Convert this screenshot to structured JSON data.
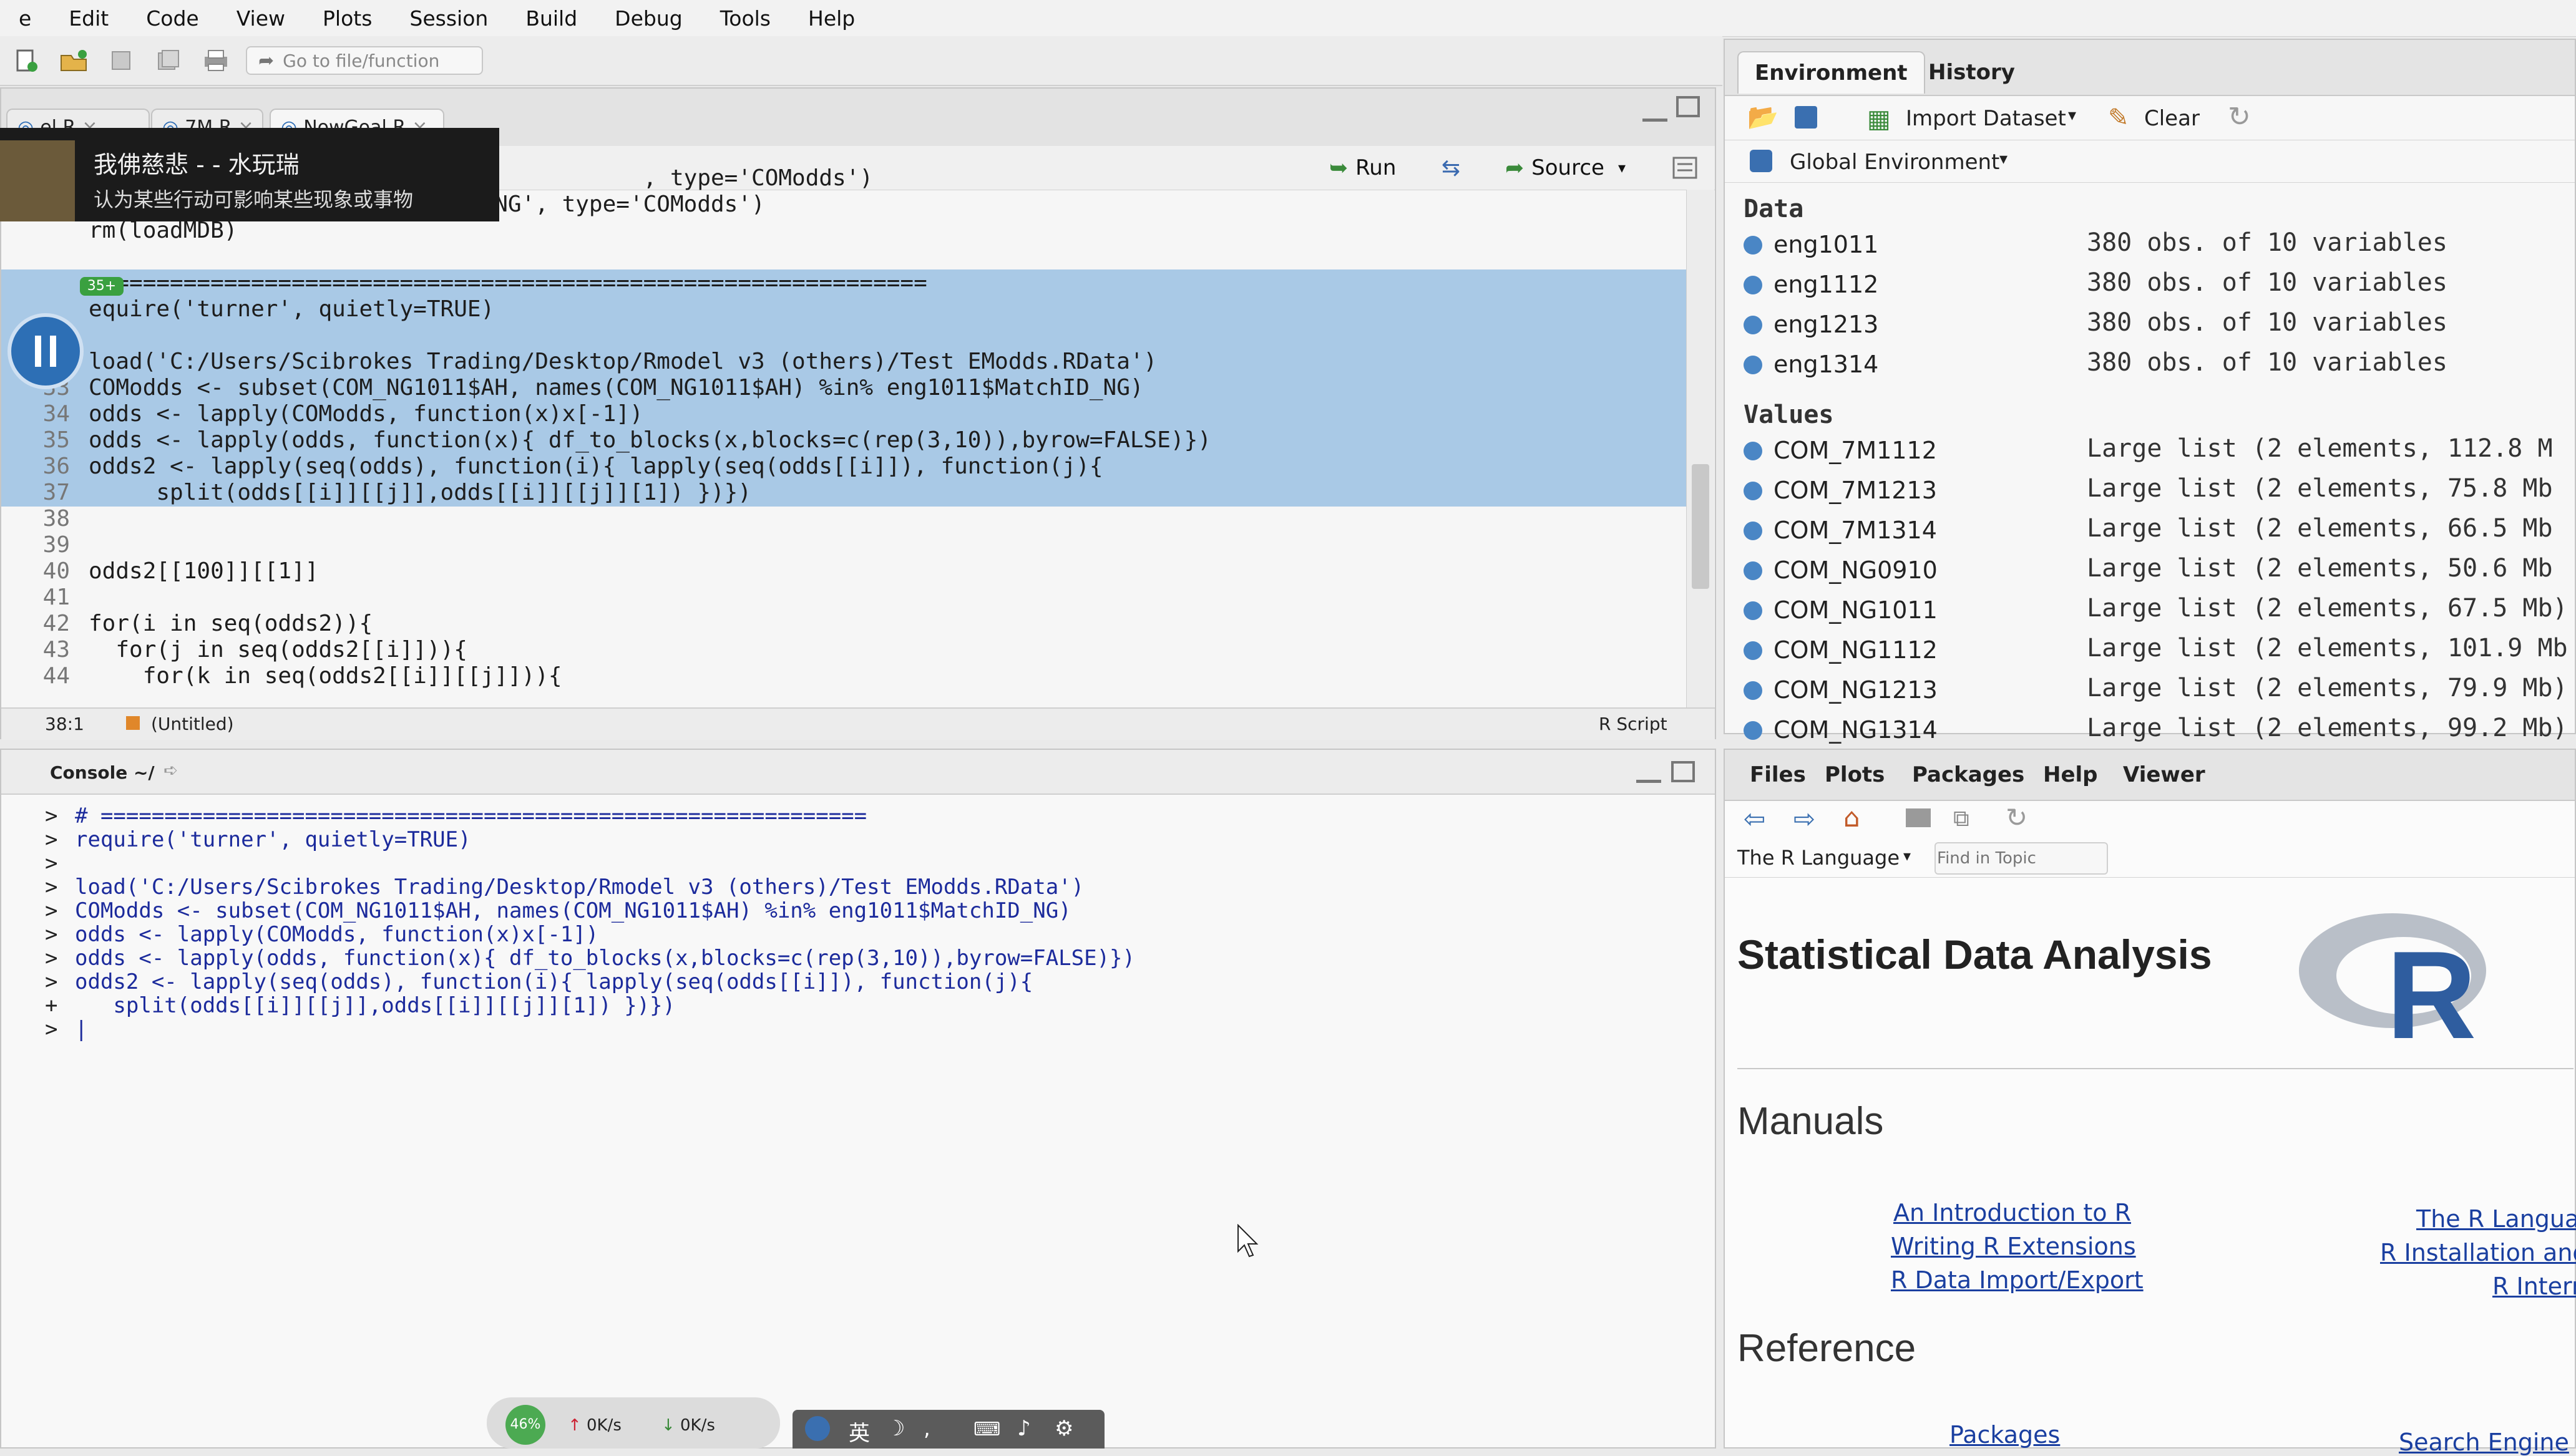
{
  "menubar": [
    "e",
    "Edit",
    "Code",
    "View",
    "Plots",
    "Session",
    "Build",
    "Debug",
    "Tools",
    "Help"
  ],
  "toolbar": {
    "goto_placeholder": "Go to file/function"
  },
  "editor": {
    "tabs": [
      "el.R",
      "7M.R",
      "NowGoal.R"
    ],
    "run_label": "Run",
    "source_label": "Source",
    "lines": [
      {
        "num": "",
        "text": "                                         , type='COModds')",
        "sel": false
      },
      {
        "num": "20",
        "text": "COM_NG1314 <- loadMDB('201314_NG', type='COModds')",
        "sel": false
      },
      {
        "num": "",
        "text": "rm(loadMDB)",
        "sel": false
      },
      {
        "num": "",
        "text": "",
        "sel": false
      },
      {
        "num": "",
        "text": "  ============================================================",
        "sel": true
      },
      {
        "num": "",
        "text": "equire('turner', quietly=TRUE)",
        "sel": true
      },
      {
        "num": "",
        "text": "",
        "sel": true
      },
      {
        "num": "32",
        "text": "load('C:/Users/Scibrokes Trading/Desktop/Rmodel v3 (others)/Test EModds.RData')",
        "sel": true
      },
      {
        "num": "33",
        "text": "COModds <- subset(COM_NG1011$AH, names(COM_NG1011$AH) %in% eng1011$MatchID_NG)",
        "sel": true
      },
      {
        "num": "34",
        "text": "odds <- lapply(COModds, function(x)x[-1])",
        "sel": true
      },
      {
        "num": "35",
        "text": "odds <- lapply(odds, function(x){ df_to_blocks(x,blocks=c(rep(3,10)),byrow=FALSE)})",
        "sel": true
      },
      {
        "num": "36",
        "text": "odds2 <- lapply(seq(odds), function(i){ lapply(seq(odds[[i]]), function(j){",
        "sel": true
      },
      {
        "num": "37",
        "text": "     split(odds[[i]][[j]],odds[[i]][[j]][1]) })})",
        "sel": true
      },
      {
        "num": "38",
        "text": "",
        "sel": false
      },
      {
        "num": "39",
        "text": "",
        "sel": false
      },
      {
        "num": "40",
        "text": "odds2[[100]][[1]]",
        "sel": false
      },
      {
        "num": "41",
        "text": "",
        "sel": false
      },
      {
        "num": "42",
        "text": "for(i in seq(odds2)){",
        "sel": false
      },
      {
        "num": "43",
        "text": "  for(j in seq(odds2[[i]])){",
        "sel": false
      },
      {
        "num": "44",
        "text": "    for(k in seq(odds2[[i]][[j]])){",
        "sel": false
      }
    ],
    "status_pos": "38:1",
    "status_context": "(Untitled)",
    "status_type": "R Script"
  },
  "console": {
    "title": "Console ~/",
    "lines": [
      {
        "p": ">",
        "t": "# ============================================================"
      },
      {
        "p": ">",
        "t": "require('turner', quietly=TRUE)"
      },
      {
        "p": ">",
        "t": ""
      },
      {
        "p": ">",
        "t": "load('C:/Users/Scibrokes Trading/Desktop/Rmodel v3 (others)/Test EModds.RData')"
      },
      {
        "p": ">",
        "t": "COModds <- subset(COM_NG1011$AH, names(COM_NG1011$AH) %in% eng1011$MatchID_NG)"
      },
      {
        "p": ">",
        "t": "odds <- lapply(COModds, function(x)x[-1])"
      },
      {
        "p": ">",
        "t": "odds <- lapply(odds, function(x){ df_to_blocks(x,blocks=c(rep(3,10)),byrow=FALSE)})"
      },
      {
        "p": ">",
        "t": "odds2 <- lapply(seq(odds), function(i){ lapply(seq(odds[[i]]), function(j){"
      },
      {
        "p": "+",
        "t": "   split(odds[[i]][[j]],odds[[i]][[j]][1]) })})"
      },
      {
        "p": ">",
        "t": "|"
      }
    ]
  },
  "environment": {
    "tabs": [
      "Environment",
      "History"
    ],
    "import_label": "Import Dataset",
    "clear_label": "Clear",
    "scope_label": "Global Environment",
    "data_heading": "Data",
    "data": [
      {
        "name": "eng1011",
        "value": "380 obs. of 10 variables"
      },
      {
        "name": "eng1112",
        "value": "380 obs. of 10 variables"
      },
      {
        "name": "eng1213",
        "value": "380 obs. of 10 variables"
      },
      {
        "name": "eng1314",
        "value": "380 obs. of 10 variables"
      }
    ],
    "values_heading": "Values",
    "values": [
      {
        "name": "COM_7M1112",
        "value": "Large list (2 elements, 112.8 M"
      },
      {
        "name": "COM_7M1213",
        "value": "Large list (2 elements, 75.8 Mb"
      },
      {
        "name": "COM_7M1314",
        "value": "Large list (2 elements, 66.5 Mb"
      },
      {
        "name": "COM_NG0910",
        "value": "Large list (2 elements, 50.6 Mb"
      },
      {
        "name": "COM_NG1011",
        "value": "Large list (2 elements, 67.5 Mb)"
      },
      {
        "name": "COM_NG1112",
        "value": "Large list (2 elements, 101.9 Mb"
      },
      {
        "name": "COM_NG1213",
        "value": "Large list (2 elements, 79.9 Mb)"
      },
      {
        "name": "COM_NG1314",
        "value": "Large list (2 elements, 99.2 Mb)"
      }
    ]
  },
  "help": {
    "tabs": [
      "Files",
      "Plots",
      "Packages",
      "Help",
      "Viewer"
    ],
    "topic_label": "The R Language",
    "find_placeholder": "Find in Topic",
    "title": "Statistical Data Analysis",
    "manuals_heading": "Manuals",
    "links_left": [
      "An Introduction to R",
      "Writing R Extensions",
      "R Data Import/Export"
    ],
    "links_right": [
      "The R Langua",
      "R Installation and",
      "R Intern"
    ],
    "reference_heading": "Reference",
    "ref_link": "Packages",
    "ref_right": "Search Engine"
  },
  "overlay": {
    "title": "我佛慈悲 - - 水玩瑞",
    "subtitle": "认为某些行动可影响某些现象或事物",
    "badge": "35+",
    "netbar_pct": "46%",
    "net_up": "0K/s",
    "net_down": "0K/s",
    "ime": "英"
  }
}
